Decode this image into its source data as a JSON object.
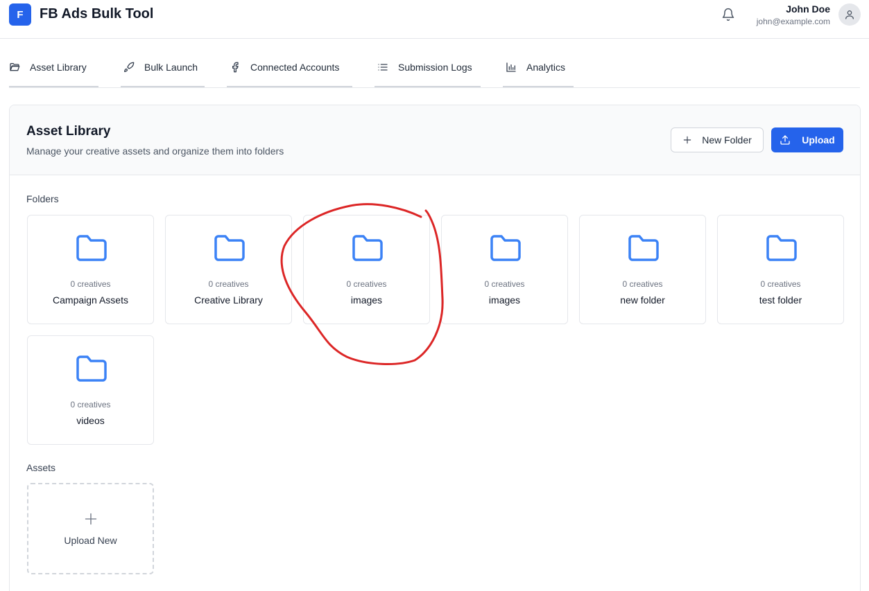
{
  "app": {
    "logo_letter": "F",
    "title": "FB Ads Bulk Tool"
  },
  "user": {
    "name": "John Doe",
    "email": "john@example.com"
  },
  "tabs": [
    {
      "label": "Asset Library",
      "icon": "folder-open-icon"
    },
    {
      "label": "Bulk Launch",
      "icon": "rocket-icon"
    },
    {
      "label": "Connected Accounts",
      "icon": "facebook-icon"
    },
    {
      "label": "Submission Logs",
      "icon": "list-icon"
    },
    {
      "label": "Analytics",
      "icon": "bar-chart-icon"
    }
  ],
  "page": {
    "title": "Asset Library",
    "subtitle": "Manage your creative assets and organize them into folders",
    "new_folder_label": "New Folder",
    "upload_label": "Upload"
  },
  "folders_label": "Folders",
  "folders": [
    {
      "count": "0 creatives",
      "name": "Campaign Assets"
    },
    {
      "count": "0 creatives",
      "name": "Creative Library"
    },
    {
      "count": "0 creatives",
      "name": "images"
    },
    {
      "count": "0 creatives",
      "name": "images"
    },
    {
      "count": "0 creatives",
      "name": "new folder"
    },
    {
      "count": "0 creatives",
      "name": "test folder"
    },
    {
      "count": "0 creatives",
      "name": "videos"
    }
  ],
  "assets_label": "Assets",
  "upload_new_label": "Upload New",
  "colors": {
    "accent": "#2563eb",
    "folder_icon": "#3b82f6",
    "annotation": "#dc2626"
  }
}
